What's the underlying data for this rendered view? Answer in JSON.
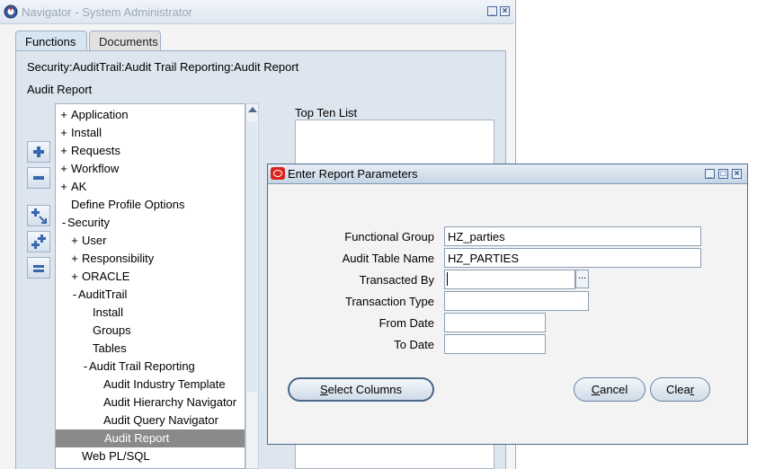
{
  "navigator": {
    "title": "Navigator - System Administrator",
    "tabs": [
      {
        "label": "Functions"
      },
      {
        "label": "Documents"
      }
    ],
    "breadcrumb": "Security:AuditTrail:Audit Trail Reporting:Audit Report",
    "form_title": "Audit Report",
    "toolbar_icons": [
      "expand-icon",
      "collapse-icon",
      "expand-branch-icon",
      "expand-all-icon",
      "collapse-all-icon"
    ],
    "tree": [
      {
        "expander": "+",
        "label": "Application",
        "selected": false
      },
      {
        "expander": "+",
        "label": "Install",
        "selected": false
      },
      {
        "expander": "+",
        "label": "Requests",
        "selected": false
      },
      {
        "expander": "+",
        "label": "Workflow",
        "selected": false
      },
      {
        "expander": "+",
        "label": "AK",
        "selected": false
      },
      {
        "expander": "",
        "label": "Define Profile Options",
        "selected": false
      },
      {
        "expander": "-",
        "label": "Security",
        "selected": false
      },
      {
        "expander": "+",
        "label": "User",
        "selected": false
      },
      {
        "expander": "+",
        "label": "Responsibility",
        "selected": false
      },
      {
        "expander": "+",
        "label": "ORACLE",
        "selected": false
      },
      {
        "expander": "-",
        "label": "AuditTrail",
        "selected": false
      },
      {
        "expander": "",
        "label": "Install",
        "selected": false
      },
      {
        "expander": "",
        "label": "Groups",
        "selected": false
      },
      {
        "expander": "",
        "label": "Tables",
        "selected": false
      },
      {
        "expander": "-",
        "label": "Audit Trail Reporting",
        "selected": false
      },
      {
        "expander": "",
        "label": "Audit Industry Template",
        "selected": false
      },
      {
        "expander": "",
        "label": "Audit Hierarchy Navigator",
        "selected": false
      },
      {
        "expander": "",
        "label": "Audit Query Navigator",
        "selected": false
      },
      {
        "expander": "",
        "label": "Audit Report",
        "selected": true
      },
      {
        "expander": "",
        "label": "Web PL/SQL",
        "selected": false
      }
    ],
    "top_ten_label": "Top Ten List"
  },
  "dialog": {
    "title": "Enter Report Parameters",
    "fields": {
      "functional_group": {
        "label": "Functional Group",
        "value": "HZ_parties"
      },
      "audit_table_name": {
        "label": "Audit Table Name",
        "value": "HZ_PARTIES"
      },
      "transacted_by": {
        "label": "Transacted By",
        "value": "",
        "lov_label": "..."
      },
      "transaction_type": {
        "label": "Transaction Type",
        "value": ""
      },
      "from_date": {
        "label": "From Date",
        "value": ""
      },
      "to_date": {
        "label": "To Date",
        "value": ""
      }
    },
    "buttons": {
      "select_columns": {
        "mnemonic": "S",
        "rest": "elect Columns"
      },
      "cancel": {
        "mnemonic": "C",
        "rest": "ancel"
      },
      "clear": {
        "pre": "Clea",
        "mnemonic": "r"
      }
    }
  },
  "colors": {
    "selection": "#8a8a8a",
    "panel": "#dde6ee",
    "oracle_red": "#d9231c"
  }
}
